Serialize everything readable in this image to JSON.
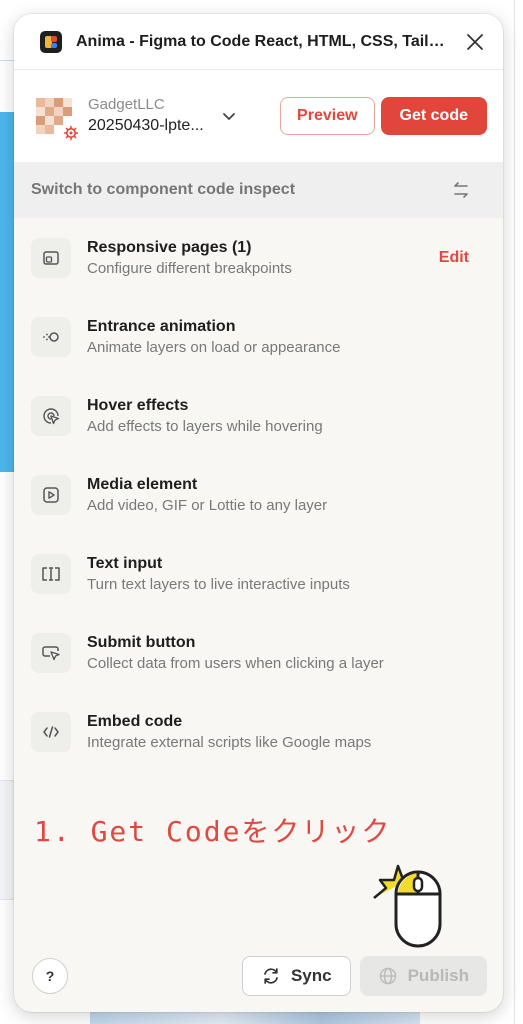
{
  "window": {
    "title": "Anima - Figma to Code React, HTML, CSS, Tailwi...",
    "close_icon": "close-icon"
  },
  "team": {
    "name": "GadgetLLC",
    "project": "20250430-lpte...",
    "dropdown_icon": "chevron-down-icon"
  },
  "toolbar": {
    "preview_label": "Preview",
    "get_code_label": "Get code"
  },
  "switch_bar": {
    "label": "Switch to component code inspect",
    "icon": "swap-arrows-icon"
  },
  "features": [
    {
      "title": "Responsive pages (1)",
      "description": "Configure different breakpoints",
      "icon": "responsive-icon",
      "action": "Edit"
    },
    {
      "title": "Entrance animation",
      "description": "Animate layers on load or appearance",
      "icon": "animation-icon"
    },
    {
      "title": "Hover effects",
      "description": "Add effects to layers while hovering",
      "icon": "hover-cursor-icon"
    },
    {
      "title": "Media element",
      "description": "Add video, GIF or Lottie to any layer",
      "icon": "play-icon"
    },
    {
      "title": "Text input",
      "description": "Turn text layers to live interactive inputs",
      "icon": "text-input-icon"
    },
    {
      "title": "Submit button",
      "description": "Collect data from users when clicking a layer",
      "icon": "submit-cursor-icon"
    },
    {
      "title": "Embed code",
      "description": "Integrate external scripts like Google maps",
      "icon": "code-icon"
    }
  ],
  "annotation": {
    "text": "1. Get Codeをクリック"
  },
  "footer": {
    "help_label": "?",
    "sync_label": "Sync",
    "publish_label": "Publish"
  },
  "colors": {
    "accent": "#e2453a",
    "panel_bg": "#f8f7f4"
  }
}
